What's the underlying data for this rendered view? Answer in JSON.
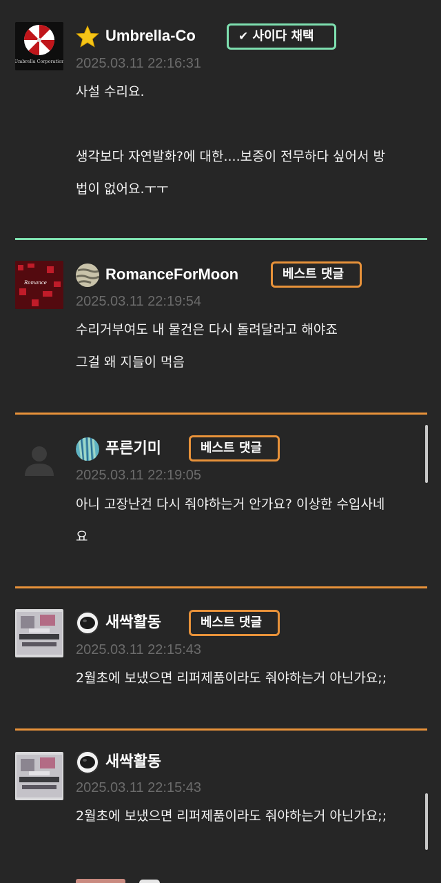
{
  "colors": {
    "background": "#262626",
    "accepted_divider": "#7ee0b0",
    "best_divider": "#e8923a",
    "date_text": "#6b6b6b"
  },
  "comments": [
    {
      "nickname": "Umbrella-Co",
      "badge_icon": "star-icon",
      "avatar_text": "Umbrella Corporation",
      "tag": "사이다 채택",
      "tag_icon": "check-icon",
      "date": "2025.03.11 22:16:31",
      "lines": [
        "사설 수리요.",
        "",
        "생각보다 자연발화?에 대한....보증이 전무하다 싶어서 방",
        "법이 없어요.ㅜㅜ"
      ]
    },
    {
      "nickname": "RomanceForMoon",
      "badge_icon": "moon-icon",
      "avatar_text": "Romance",
      "tag": "베스트 댓글",
      "date": "2025.03.11 22:19:54",
      "lines": [
        "수리거부여도 내 물건은 다시 돌려달라고 해야죠",
        "그걸 왜 지들이 먹음"
      ]
    },
    {
      "nickname": "푸른기미",
      "badge_icon": "stripes-icon",
      "tag": "베스트 댓글",
      "date": "2025.03.11 22:19:05",
      "lines": [
        "아니 고장난건 다시 줘야하는거 안가요? 이상한 수입사네",
        "요"
      ]
    },
    {
      "nickname": "새싹활동",
      "badge_icon": "astronaut-icon",
      "tag": "베스트 댓글",
      "date": "2025.03.11 22:15:43",
      "lines": [
        "2월초에 보냈으면 리퍼제품이라도 줘야하는거 아닌가요;;"
      ]
    },
    {
      "nickname": "새싹활동",
      "badge_icon": "astronaut-icon",
      "date": "2025.03.11 22:15:43",
      "lines": [
        "2월초에 보냈으면 리퍼제품이라도 줘야하는거 아닌가요;;"
      ]
    }
  ]
}
